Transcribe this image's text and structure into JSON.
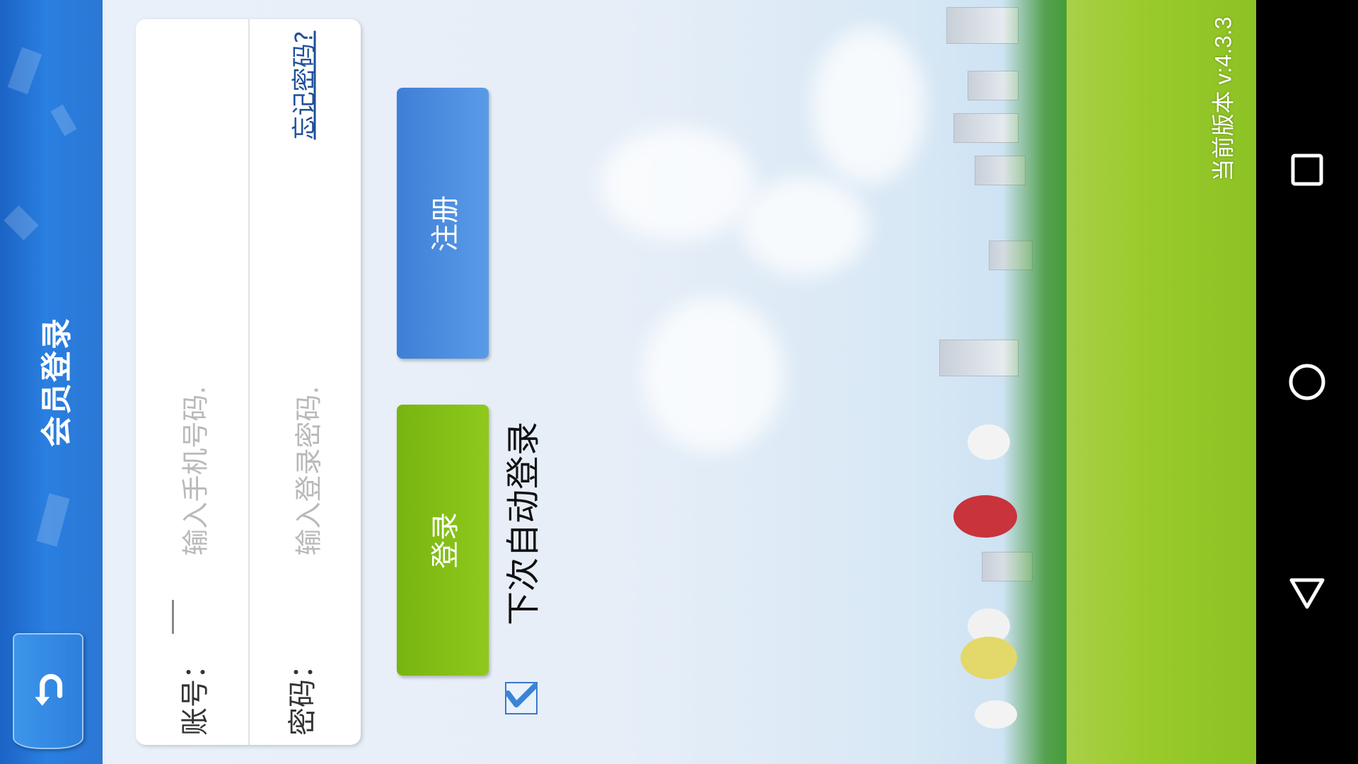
{
  "header": {
    "title": "会员登录",
    "back_icon": "undo-arrow-icon"
  },
  "login_form": {
    "account_label": "账号：",
    "account_placeholder": "输入手机号码.",
    "password_label": "密码：",
    "password_placeholder": "输入登录密码.",
    "forgot_password_link": "忘记密码?"
  },
  "buttons": {
    "login_label": "登录",
    "register_label": "注册"
  },
  "auto_login": {
    "label": "下次自动登录",
    "checked": true
  },
  "footer": {
    "version_text": "当前版本 v:4.3.3"
  },
  "navbar": {
    "back_icon": "triangle-back-icon",
    "home_icon": "circle-home-icon",
    "recents_icon": "square-recents-icon"
  },
  "colors": {
    "header_blue": "#2a7fe0",
    "login_green": "#8fc91c",
    "register_blue": "#4a8ddf",
    "link_blue": "#1e4f9a"
  }
}
